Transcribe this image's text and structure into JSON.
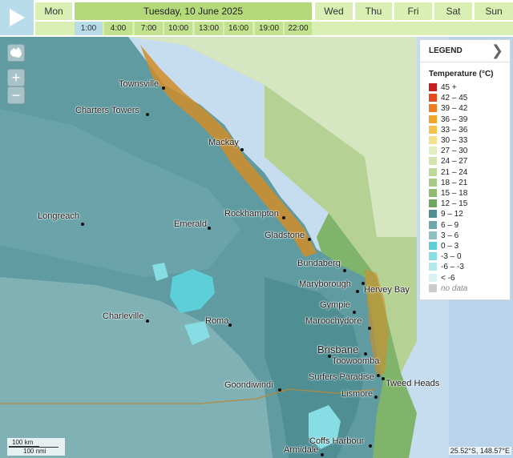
{
  "days": [
    {
      "label": "Mon",
      "active": false
    },
    {
      "label": "Tuesday, 10 June 2025",
      "active": true
    },
    {
      "label": "Wed",
      "active": false
    },
    {
      "label": "Thu",
      "active": false
    },
    {
      "label": "Fri",
      "active": false
    },
    {
      "label": "Sat",
      "active": false
    },
    {
      "label": "Sun",
      "active": false
    }
  ],
  "times": [
    "1:00",
    "4:00",
    "7:00",
    "10:00",
    "13:00",
    "16:00",
    "19:00",
    "22:00"
  ],
  "active_time": "1:00",
  "controls": {
    "zoom_in": "+",
    "zoom_out": "−"
  },
  "legend": {
    "title": "LEGEND",
    "subtitle": "Temperature (°C)",
    "items": [
      {
        "label": "45 +",
        "color": "#c41e1e"
      },
      {
        "label": "42 – 45",
        "color": "#e54b1d"
      },
      {
        "label": "39 – 42",
        "color": "#f07c1f"
      },
      {
        "label": "36 – 39",
        "color": "#f3a52a"
      },
      {
        "label": "33 – 36",
        "color": "#f6c24c"
      },
      {
        "label": "30 – 33",
        "color": "#f5e08e"
      },
      {
        "label": "27 – 30",
        "color": "#e3efc2"
      },
      {
        "label": "24 – 27",
        "color": "#d2e5ae"
      },
      {
        "label": "21 – 24",
        "color": "#bcd99a"
      },
      {
        "label": "18 – 21",
        "color": "#a6cb86"
      },
      {
        "label": "15 – 18",
        "color": "#8fbc72"
      },
      {
        "label": "12 – 15",
        "color": "#6fa562"
      },
      {
        "label": "9 – 12",
        "color": "#4f8f94"
      },
      {
        "label": "6 – 9",
        "color": "#6fa6ac"
      },
      {
        "label": "3 – 6",
        "color": "#8fbec3"
      },
      {
        "label": "0 – 3",
        "color": "#5dcfd8"
      },
      {
        "label": "-3 – 0",
        "color": "#86dde3"
      },
      {
        "label": "-6 – -3",
        "color": "#b2e9ec"
      },
      {
        "label": "< -6",
        "color": "#d9f3f4"
      },
      {
        "label": "no data",
        "color": "#cccccc"
      }
    ]
  },
  "cities": [
    {
      "name": "Townsville"
    },
    {
      "name": "Charters Towers"
    },
    {
      "name": "Mackay"
    },
    {
      "name": "Longreach"
    },
    {
      "name": "Emerald"
    },
    {
      "name": "Rockhampton"
    },
    {
      "name": "Gladstone"
    },
    {
      "name": "Bundaberg"
    },
    {
      "name": "Maryborough"
    },
    {
      "name": "Hervey Bay"
    },
    {
      "name": "Gympie"
    },
    {
      "name": "Maroochydore"
    },
    {
      "name": "Charleville"
    },
    {
      "name": "Roma"
    },
    {
      "name": "Brisbane"
    },
    {
      "name": "Toowoomba"
    },
    {
      "name": "Surfers Paradise"
    },
    {
      "name": "Tweed Heads"
    },
    {
      "name": "Goondiwindi"
    },
    {
      "name": "Lismore"
    },
    {
      "name": "Coffs Harbour"
    },
    {
      "name": "Armidale"
    }
  ],
  "scale": {
    "km": "100 km",
    "nmi": "100 nmi"
  },
  "coordinates": "25.52°S, 148.57°E"
}
